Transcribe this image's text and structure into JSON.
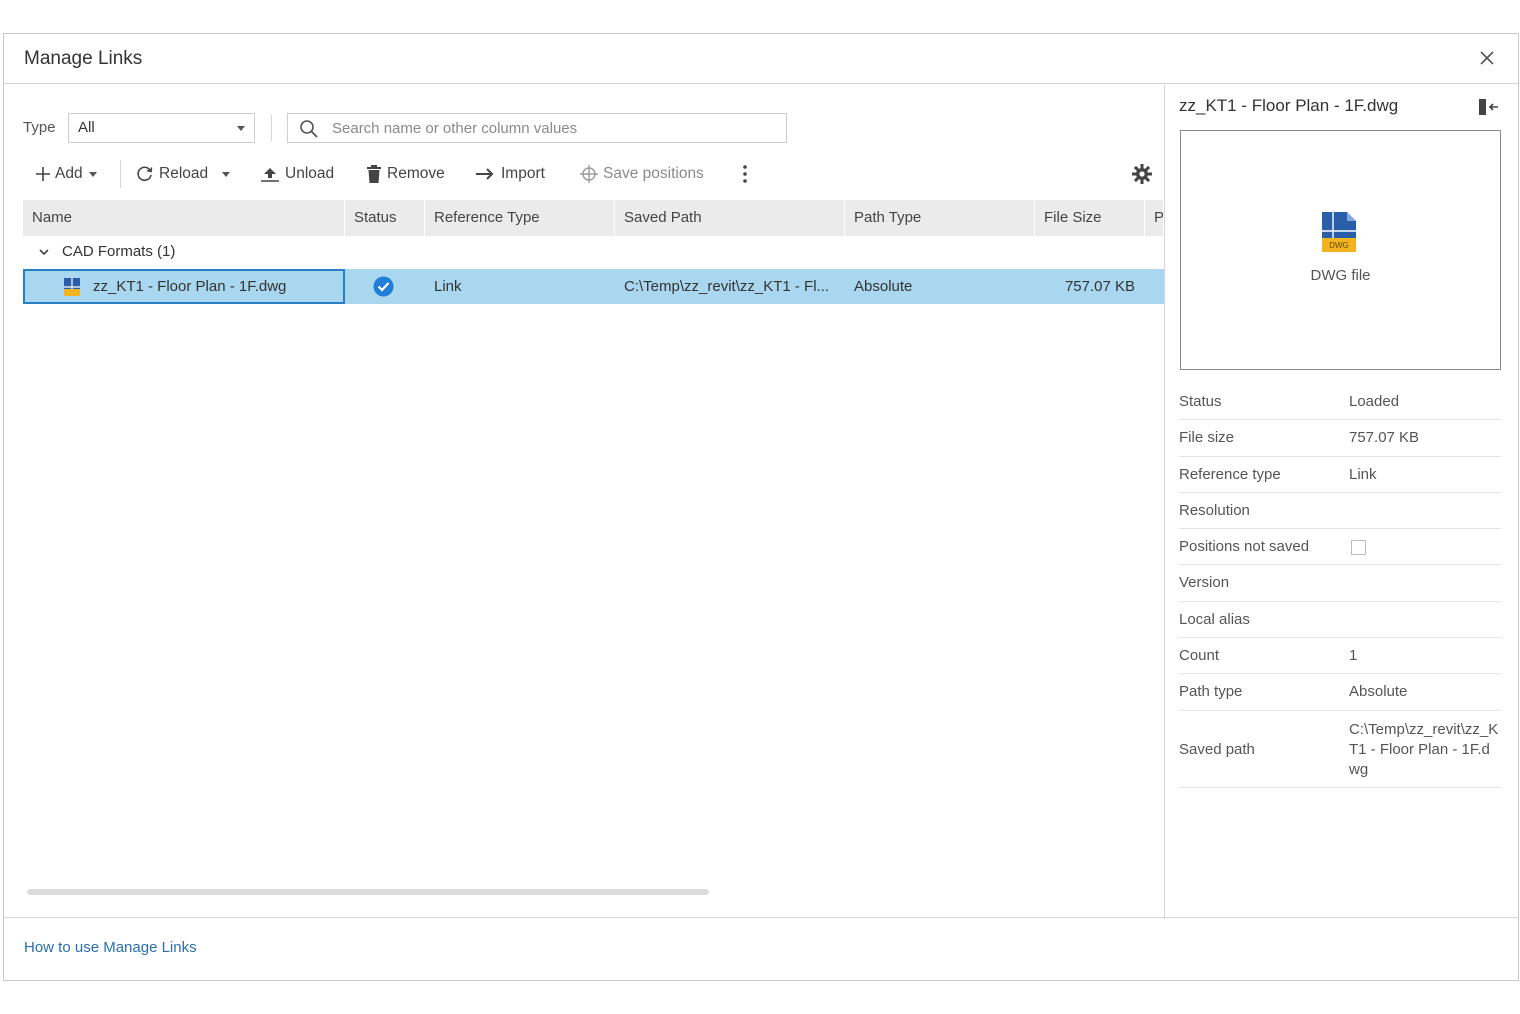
{
  "dialog": {
    "title": "Manage Links",
    "close_icon": "close-icon"
  },
  "filter": {
    "type_label": "Type",
    "type_value": "All",
    "search_placeholder": "Search name or other column values",
    "search_icon": "search-icon"
  },
  "toolbar": {
    "add": "Add",
    "reload": "Reload",
    "unload": "Unload",
    "remove": "Remove",
    "import": "Import",
    "save_positions": "Save positions",
    "more_icon": "more-vertical-icon",
    "settings_icon": "gear-icon"
  },
  "table": {
    "columns": [
      "Name",
      "Status",
      "Reference Type",
      "Saved Path",
      "Path Type",
      "File Size",
      "P"
    ],
    "group": {
      "label": "CAD Formats",
      "count": "(1)"
    },
    "rows": [
      {
        "name": "zz_KT1 - Floor Plan - 1F.dwg",
        "status_icon": "check-circle-icon",
        "reference_type": "Link",
        "saved_path": "C:\\Temp\\zz_revit\\zz_KT1 - Fl...",
        "path_type": "Absolute",
        "file_size": "757.07 KB"
      }
    ]
  },
  "details": {
    "title": "zz_KT1 - Floor Plan - 1F.dwg",
    "preview_label": "DWG file",
    "preview_icon_text": "DWG",
    "properties": {
      "status": {
        "label": "Status",
        "value": "Loaded"
      },
      "file_size": {
        "label": "File size",
        "value": "757.07 KB"
      },
      "reference_type": {
        "label": "Reference type",
        "value": "Link"
      },
      "resolution": {
        "label": "Resolution",
        "value": ""
      },
      "positions_not_saved": {
        "label": "Positions not saved",
        "checked": false
      },
      "version": {
        "label": "Version",
        "value": ""
      },
      "local_alias": {
        "label": "Local alias",
        "value": ""
      },
      "count": {
        "label": "Count",
        "value": "1"
      },
      "path_type": {
        "label": "Path type",
        "value": "Absolute"
      },
      "saved_path": {
        "label": "Saved path",
        "value": "C:\\Temp\\zz_revit\\zz_KT1 - Floor Plan - 1F.dwg"
      }
    }
  },
  "footer": {
    "help_link": "How to use Manage Links"
  },
  "colors": {
    "selection": "#a8d7ef",
    "selection_border": "#2a7fc4",
    "link": "#2a6fb0",
    "status_check": "#1f7ed6"
  }
}
